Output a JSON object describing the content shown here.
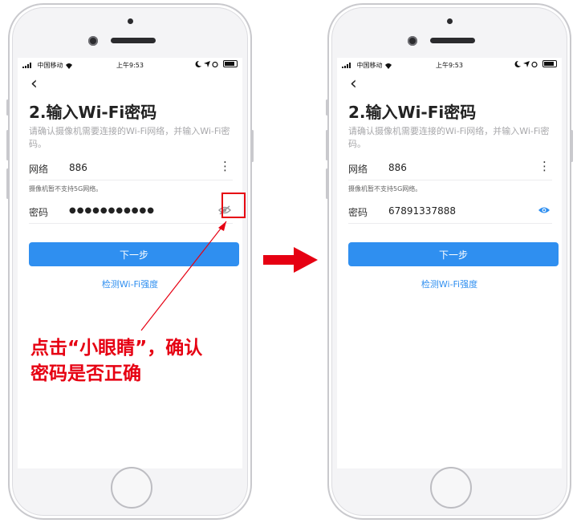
{
  "phones": {
    "left": {
      "status": {
        "carrier": "中国移动",
        "time": "上午9:53"
      },
      "title": "2.输入Wi-Fi密码",
      "description": "请确认摄像机需要连接的Wi-Fi网络，并输入Wi-Fi密码。",
      "network": {
        "label": "网络",
        "value": "886"
      },
      "hint": "摄像机暂不支持5G网络。",
      "password": {
        "label": "密码",
        "value": "●●●●●●●●●●●",
        "visible": false
      },
      "next_label": "下一步",
      "check_link": "检测Wi-Fi强度"
    },
    "right": {
      "status": {
        "carrier": "中国移动",
        "time": "上午9:53"
      },
      "title": "2.输入Wi-Fi密码",
      "description": "请确认摄像机需要连接的Wi-Fi网络，并输入Wi-Fi密码。",
      "network": {
        "label": "网络",
        "value": "886"
      },
      "hint": "摄像机暂不支持5G网络。",
      "password": {
        "label": "密码",
        "value": "67891337888",
        "visible": true
      },
      "next_label": "下一步",
      "check_link": "检测Wi-Fi强度"
    }
  },
  "annotation": {
    "line1": "点击“小眼睛”，确认",
    "line2": "密码是否正确"
  },
  "colors": {
    "accent": "#2f8ff0",
    "annotation_red": "#e60012",
    "eye_hidden": "#9a9a9e",
    "eye_visible": "#2f8ff0"
  }
}
